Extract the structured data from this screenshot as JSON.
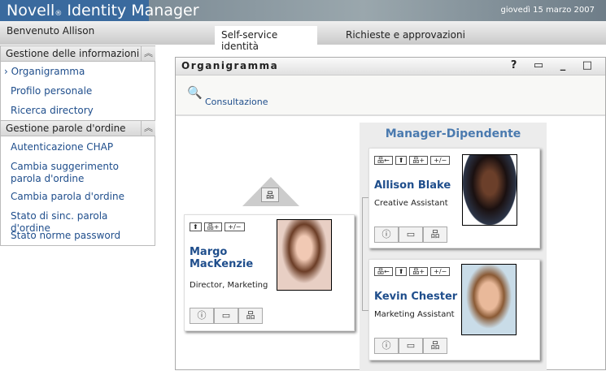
{
  "header": {
    "brand": "Novell",
    "reg": "®",
    "product": "Identity Manager",
    "date": "giovedì 15 marzo 2007"
  },
  "welcome": "Benvenuto Allison",
  "tabs": [
    {
      "label": "Self-service identità"
    },
    {
      "label": "Richieste e approvazioni"
    }
  ],
  "sidebar": {
    "sections": [
      {
        "title": "Gestione delle informazioni",
        "items": [
          "Organigramma",
          "Profilo personale",
          "Ricerca directory"
        ]
      },
      {
        "title": "Gestione parole d'ordine",
        "items": [
          "Autenticazione CHAP",
          "Cambia suggerimento parola d'ordine",
          "Cambia parola d'ordine",
          "Stato di sinc. parola d'ordine",
          "Stato norme password"
        ]
      }
    ]
  },
  "panel": {
    "title": "Organigramma",
    "controls": "? ▭ _ □",
    "tool": "Consultazione"
  },
  "relationship": "Manager-Dipendente",
  "people": [
    {
      "name": "Margo MacKenzie",
      "title": "Director, Marketing"
    },
    {
      "name": "Allison Blake",
      "title": "Creative Assistant"
    },
    {
      "name": "Kevin Chester",
      "title": "Marketing Assistant"
    }
  ],
  "colors": {
    "brand": "#3a6a9e",
    "link": "#1f4e8c"
  }
}
